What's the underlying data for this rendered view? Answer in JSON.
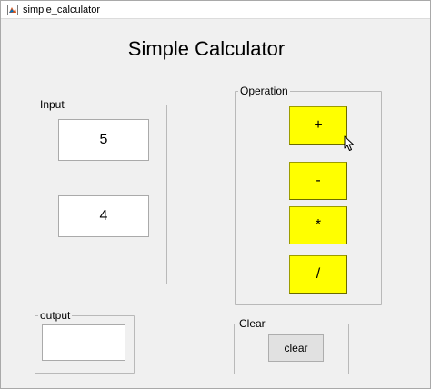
{
  "window": {
    "title": "simple_calculator"
  },
  "header": {
    "title": "Simple Calculator"
  },
  "input_panel": {
    "label": "Input",
    "first_value": "5",
    "second_value": "4"
  },
  "operation_panel": {
    "label": "Operation",
    "buttons": [
      {
        "label": "+"
      },
      {
        "label": "-"
      },
      {
        "label": "*"
      },
      {
        "label": "/"
      }
    ]
  },
  "output_panel": {
    "label": "output",
    "value": ""
  },
  "clear_panel": {
    "label": "Clear",
    "button_label": "clear"
  },
  "colors": {
    "operation_button": "#ffff00",
    "background": "#f0f0f0"
  },
  "icons": {
    "app": "matlab-figure-icon",
    "pointer": "mouse-cursor-icon"
  }
}
